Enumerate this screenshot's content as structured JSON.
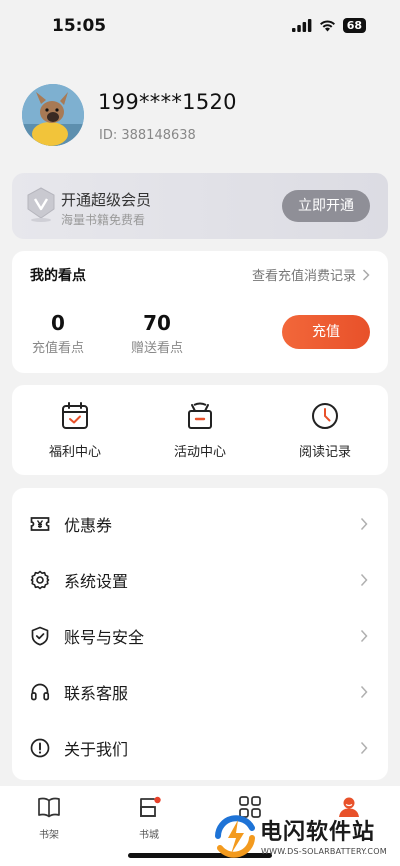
{
  "status_bar": {
    "time": "15:05",
    "battery": "68"
  },
  "profile": {
    "phone": "199****1520",
    "id": "ID: 388148638"
  },
  "vip": {
    "title": "开通超级会员",
    "subtitle": "海量书籍免费看",
    "button": "立即开通"
  },
  "points": {
    "title": "我的看点",
    "records_link": "查看充值消费记录",
    "stats": [
      {
        "value": "0",
        "label": "充值看点"
      },
      {
        "value": "70",
        "label": "赠送看点"
      }
    ],
    "recharge_button": "充值"
  },
  "quick_actions": [
    {
      "label": "福利中心",
      "icon": "calendar-check-icon"
    },
    {
      "label": "活动中心",
      "icon": "gift-icon"
    },
    {
      "label": "阅读记录",
      "icon": "clock-icon"
    }
  ],
  "menu": [
    {
      "label": "优惠券",
      "icon": "coupon-icon"
    },
    {
      "label": "系统设置",
      "icon": "gear-icon"
    },
    {
      "label": "账号与安全",
      "icon": "shield-icon"
    },
    {
      "label": "联系客服",
      "icon": "headset-icon"
    },
    {
      "label": "关于我们",
      "icon": "info-icon"
    }
  ],
  "tabbar": [
    {
      "label": "书架",
      "icon": "book-icon"
    },
    {
      "label": "书城",
      "icon": "bookstore-icon",
      "badge": true
    },
    {
      "label": "",
      "icon": "grid-icon"
    },
    {
      "label": "",
      "icon": "profile-icon",
      "active": true
    }
  ],
  "watermark": {
    "text": "电闪软件站",
    "url": "WWW.DS-SOLARBATTERY.COM"
  },
  "colors": {
    "accent": "#e8512a",
    "vip_button": "#8f8f97",
    "background": "#f2f2f2"
  }
}
